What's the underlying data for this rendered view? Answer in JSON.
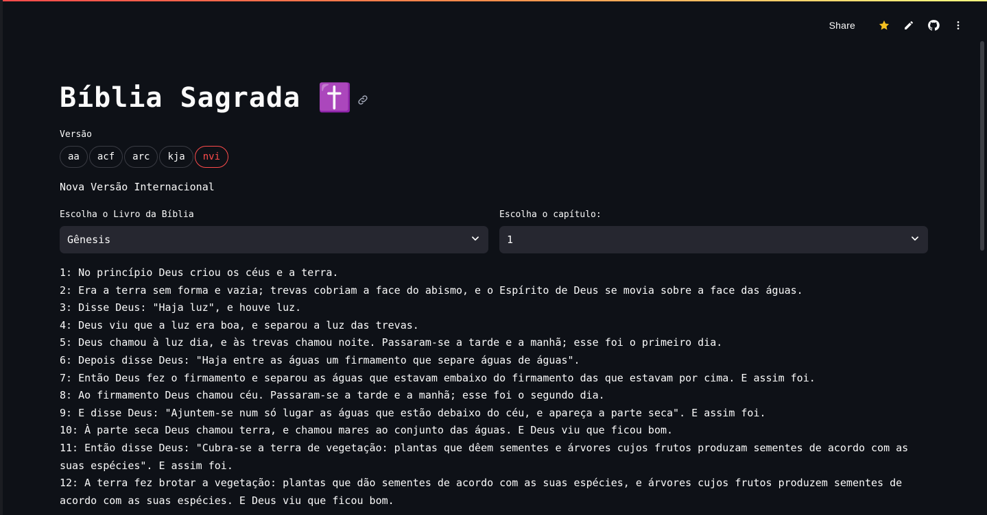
{
  "toolbar": {
    "share_label": "Share",
    "icons": [
      "star-icon",
      "pencil-icon",
      "github-icon",
      "more-vertical-icon"
    ],
    "star_color": "#f4c020"
  },
  "header": {
    "title": "Bíblia Sagrada ✝️"
  },
  "version": {
    "label": "Versão",
    "options": [
      "aa",
      "acf",
      "arc",
      "kja",
      "nvi"
    ],
    "selected": "nvi",
    "full_name": "Nova Versão Internacional",
    "accent_color": "#ff4b4b"
  },
  "book_select": {
    "label": "Escolha o Livro da Bíblia",
    "value": "Gênesis"
  },
  "chapter_select": {
    "label": "Escolha o capítulo:",
    "value": "1"
  },
  "verses": [
    "1: No princípio Deus criou os céus e a terra.",
    "2: Era a terra sem forma e vazia; trevas cobriam a face do abismo, e o Espírito de Deus se movia sobre a face das águas.",
    "3: Disse Deus: \"Haja luz\", e houve luz.",
    "4: Deus viu que a luz era boa, e separou a luz das trevas.",
    "5: Deus chamou à luz dia, e às trevas chamou noite. Passaram-se a tarde e a manhã; esse foi o primeiro dia.",
    "6: Depois disse Deus: \"Haja entre as águas um firmamento que separe águas de águas\".",
    "7: Então Deus fez o firmamento e separou as águas que estavam embaixo do firmamento das que estavam por cima. E assim foi.",
    "8: Ao firmamento Deus chamou céu. Passaram-se a tarde e a manhã; esse foi o segundo dia.",
    "9: E disse Deus: \"Ajuntem-se num só lugar as águas que estão debaixo do céu, e apareça a parte seca\". E assim foi.",
    "10: À parte seca Deus chamou terra, e chamou mares ao conjunto das águas. E Deus viu que ficou bom.",
    "11: Então disse Deus: \"Cubra-se a terra de vegetação: plantas que dêem sementes e árvores cujos frutos produzam sementes de acordo com as suas espécies\". E assim foi.",
    "12: A terra fez brotar a vegetação: plantas que dão sementes de acordo com as suas espécies, e árvores cujos frutos produzem sementes de acordo com as suas espécies. E Deus viu que ficou bom."
  ]
}
